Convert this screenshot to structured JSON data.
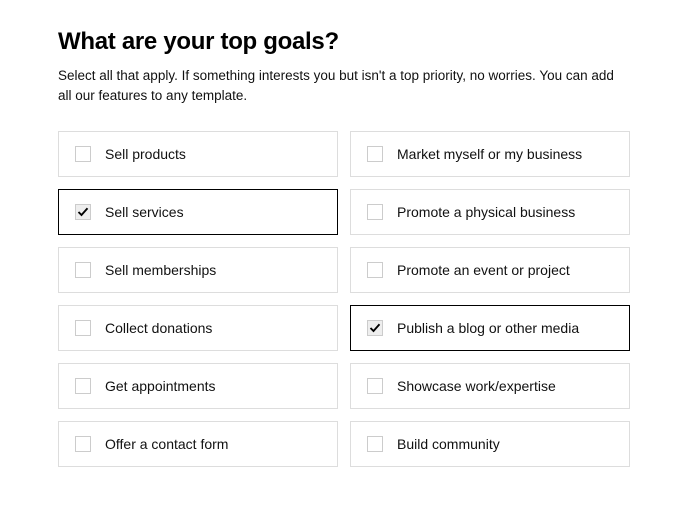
{
  "heading": "What are your top goals?",
  "subheading": "Select all that apply. If something interests you but isn't a top priority, no worries. You can add all our features to any template.",
  "options": [
    {
      "label": "Sell products",
      "selected": false
    },
    {
      "label": "Market myself or my business",
      "selected": false
    },
    {
      "label": "Sell services",
      "selected": true
    },
    {
      "label": "Promote a physical business",
      "selected": false
    },
    {
      "label": "Sell memberships",
      "selected": false
    },
    {
      "label": "Promote an event or project",
      "selected": false
    },
    {
      "label": "Collect donations",
      "selected": false
    },
    {
      "label": "Publish a blog or other media",
      "selected": true
    },
    {
      "label": "Get appointments",
      "selected": false
    },
    {
      "label": "Showcase work/expertise",
      "selected": false
    },
    {
      "label": "Offer a contact form",
      "selected": false
    },
    {
      "label": "Build community",
      "selected": false
    }
  ]
}
